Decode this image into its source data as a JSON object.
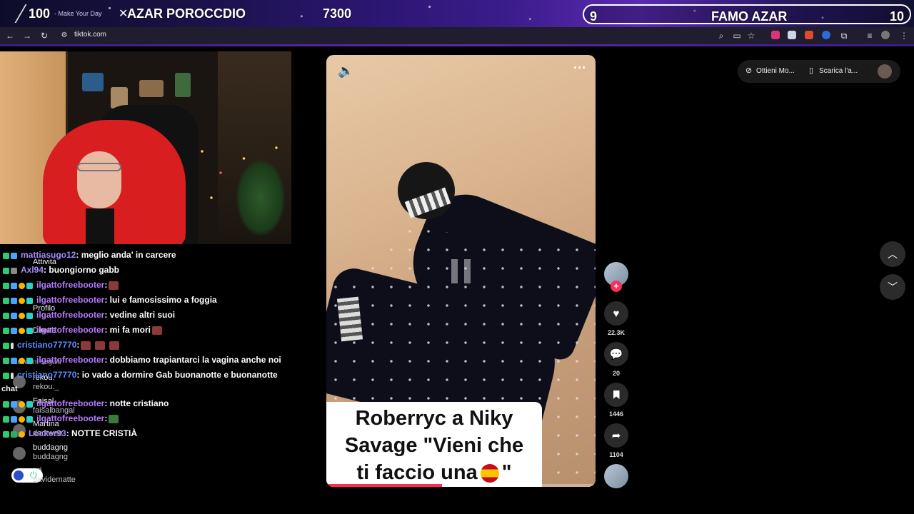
{
  "overlay": {
    "left_count": "100",
    "tagline": "- Make Your Day",
    "left_title": "AZAR POROCCDIO",
    "center_value": "7300",
    "pill_left": "9",
    "pill_title": "FAMO AZAR",
    "pill_right": "10"
  },
  "browser": {
    "url": "tiktok.com",
    "back_icon": "arrow-left-icon",
    "forward_icon": "arrow-right-icon",
    "reload_icon": "reload-icon"
  },
  "chat": {
    "messages": [
      {
        "user": "mattiasugo12",
        "color": "#a78bfa",
        "text": ": meglio anda' in carcere"
      },
      {
        "user": "Axl94",
        "color": "#a78bfa",
        "text": ": buongiorno gabb"
      },
      {
        "user": "ilgattofreebooter",
        "color": "#b77bff",
        "text": ":"
      },
      {
        "user": "ilgattofreebooter",
        "color": "#b77bff",
        "text": ": lui e famosissimo a foggia"
      },
      {
        "user": "ilgattofreebooter",
        "color": "#b77bff",
        "text": ": vedine altri suoi"
      },
      {
        "user": "ilgattofreebooter",
        "color": "#b77bff",
        "text": ": mi fa mori"
      },
      {
        "user": "cristiano77770",
        "color": "#5b8cff",
        "text": ":"
      },
      {
        "user": "ilgattofreebooter",
        "color": "#b77bff",
        "text": ": dobbiamo trapiantarci la vagina anche noi"
      },
      {
        "user": "cristiano77770",
        "color": "#5b8cff",
        "text": ": io vado a dormire Gab buonanotte e buonanotte"
      },
      {
        "user": "ilgattofreebooter",
        "color": "#b77bff",
        "text": ": notte cristiano"
      },
      {
        "user": "ilgattofreebooter",
        "color": "#b77bff",
        "text": ":"
      },
      {
        "user": "Locker93",
        "color": "#a78bfa",
        "text": ": NOTTE CRISTIÀ"
      }
    ],
    "chat_word": "chat",
    "ghost": {
      "attivita": "Attività",
      "profilo": "Profilo",
      "dirette": "Dirette",
      "account_seguiti": "Account seguiti",
      "rekou_name": "rekou.",
      "rekou_handle": "rekou._",
      "faisal_name": "Faisal",
      "faisal_handle": "faisalbangal",
      "martina_name": "Martina",
      "martina_handle": "dootwee",
      "buddagng_name": "buddagng",
      "buddagng_handle": "buddagng",
      "davide_name": "ori",
      "davide_handle": "davidematte"
    }
  },
  "video": {
    "caption_line1": "Roberryc a Niky",
    "caption_line2": "Savage \"Vieni che",
    "caption_line3a": "ti faccio una",
    "caption_line3b": "\"",
    "progress": 0.43,
    "volume_icon": "volume-icon",
    "more_icon": "more-dots-icon"
  },
  "rail": {
    "likes": "22.3K",
    "comments": "20",
    "saves": "1446",
    "shares": "1104"
  },
  "top_right": {
    "btn1": "Ottieni Mo...",
    "btn2": "Scarica l'a..."
  },
  "colors": {
    "tiktok_red": "#fe2c55",
    "overlay_purple": "#3a1c8a"
  }
}
